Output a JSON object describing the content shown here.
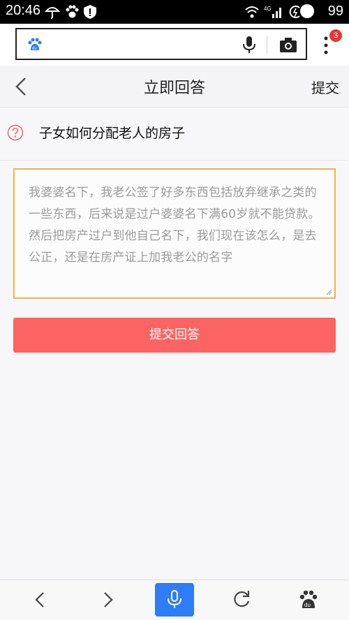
{
  "status_bar": {
    "time": "20:46",
    "battery": "99",
    "network": "4G",
    "icons": [
      "umbrella-icon",
      "paw-icon",
      "shield-icon",
      "wifi-icon",
      "signal-icon",
      "charging-icon"
    ]
  },
  "browser": {
    "url_value": "",
    "tab_badge": "3",
    "icons": [
      "baidu-logo-icon",
      "microphone-icon",
      "camera-icon",
      "more-menu-icon"
    ]
  },
  "header": {
    "title": "立即回答",
    "submit_label": "提交"
  },
  "question": {
    "text": "子女如何分配老人的房子",
    "icon": "question-mark-icon"
  },
  "answer": {
    "text": "我婆婆名下，我老公签了好多东西包括放弃继承之类的一些东西，后来说是过户婆婆名下满60岁就不能贷款。然后把房产过户到他自己名下，我们现在该怎么，是去公正，还是在房产证上加我老公的名字"
  },
  "submit_button": {
    "label": "提交回答"
  },
  "bottom_nav": {
    "items": [
      "back-arrow-icon",
      "forward-arrow-icon",
      "voice-search-icon",
      "refresh-icon",
      "baidu-home-icon"
    ]
  },
  "colors": {
    "accent_red": "#fc6463",
    "input_border": "#f0b24a",
    "voice_blue": "#2e7cf6",
    "badge_red": "#e53935"
  }
}
